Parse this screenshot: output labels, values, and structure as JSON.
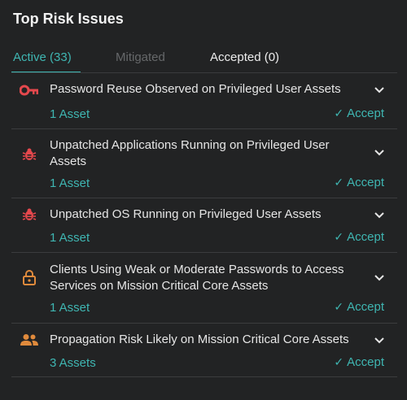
{
  "panel": {
    "title": "Top Risk Issues",
    "tabs": [
      {
        "label": "Active (33)",
        "state": "active"
      },
      {
        "label": "Mitigated",
        "state": "disabled"
      },
      {
        "label": "Accepted (0)",
        "state": "normal"
      }
    ]
  },
  "colors": {
    "accent": "#3fb6b2",
    "danger": "#e5484d",
    "warning": "#e08a3c",
    "background": "#222324"
  },
  "issues": [
    {
      "title": "Password Reuse Observed on Privileged User Assets",
      "assets": "1 Asset",
      "accept": "Accept",
      "icon": "key-icon"
    },
    {
      "title": "Unpatched Applications Running on Privileged User Assets",
      "assets": "1 Asset",
      "accept": "Accept",
      "icon": "bug-icon"
    },
    {
      "title": "Unpatched OS Running on Privileged User Assets",
      "assets": "1 Asset",
      "accept": "Accept",
      "icon": "bug-icon"
    },
    {
      "title": "Clients Using Weak or Moderate Passwords to Access Services on Mission Critical Core Assets",
      "assets": "1 Asset",
      "accept": "Accept",
      "icon": "lock-icon"
    },
    {
      "title": "Propagation Risk Likely on Mission Critical Core Assets",
      "assets": "3 Assets",
      "accept": "Accept",
      "icon": "users-icon"
    }
  ]
}
